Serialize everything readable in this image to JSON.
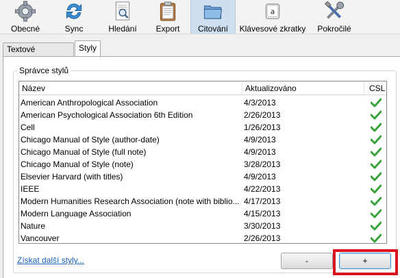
{
  "toolbar": {
    "items": [
      {
        "label": "Obecné",
        "icon": "gear-icon"
      },
      {
        "label": "Sync",
        "icon": "sync-icon"
      },
      {
        "label": "Hledání",
        "icon": "search-document-icon"
      },
      {
        "label": "Export",
        "icon": "clipboard-icon"
      },
      {
        "label": "Citování",
        "icon": "folder-icon"
      },
      {
        "label": "Klávesové zkratky",
        "icon": "keyboard-key-icon"
      },
      {
        "label": "Pokročilé",
        "icon": "tools-icon"
      }
    ],
    "active": "Citování"
  },
  "subtabs": {
    "items": [
      "Textové procesory",
      "Styly"
    ],
    "active": "Styly"
  },
  "styles_manager": {
    "title": "Správce stylů",
    "columns": {
      "name": "Název",
      "updated": "Aktualizováno",
      "csl": "CSL"
    },
    "rows": [
      {
        "name": "American Anthropological Association",
        "updated": "4/3/2013"
      },
      {
        "name": "American Psychological Association 6th Edition",
        "updated": "2/26/2013"
      },
      {
        "name": "Cell",
        "updated": "1/26/2013"
      },
      {
        "name": "Chicago Manual of Style (author-date)",
        "updated": "4/9/2013"
      },
      {
        "name": "Chicago Manual of Style (full note)",
        "updated": "4/9/2013"
      },
      {
        "name": "Chicago Manual of Style (note)",
        "updated": "3/28/2013"
      },
      {
        "name": "Elsevier Harvard (with titles)",
        "updated": "4/9/2013"
      },
      {
        "name": "IEEE",
        "updated": "4/22/2013"
      },
      {
        "name": "Modern Humanities Research Association (note with biblio...",
        "updated": "4/17/2013"
      },
      {
        "name": "Modern Language Association",
        "updated": "4/15/2013"
      },
      {
        "name": "Nature",
        "updated": "3/30/2013"
      },
      {
        "name": "Vancouver",
        "updated": "2/26/2013"
      }
    ],
    "more_link": "Získat další styly...",
    "remove_button": "-",
    "add_button": "+"
  },
  "colors": {
    "highlight": "#d8141e",
    "link": "#1a5fb4",
    "check": "#3aa23a",
    "active_tab": "#cfdff2"
  }
}
